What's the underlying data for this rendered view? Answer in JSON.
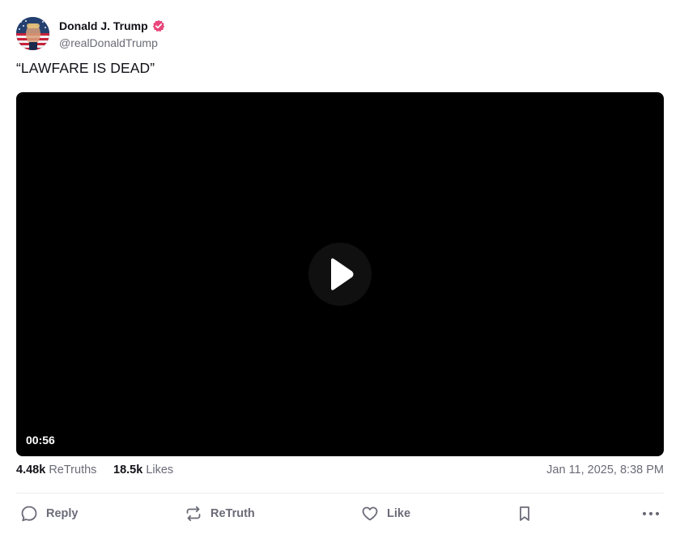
{
  "author": {
    "display_name": "Donald J. Trump",
    "handle": "@realDonaldTrump",
    "verified": true,
    "verified_color": "#e8457a"
  },
  "post": {
    "text": "“LAWFARE IS DEAD”",
    "video": {
      "duration": "00:56"
    }
  },
  "stats": {
    "retruths_count": "4.48k",
    "retruths_label": "ReTruths",
    "likes_count": "18.5k",
    "likes_label": "Likes",
    "timestamp": "Jan 11, 2025, 8:38 PM"
  },
  "actions": {
    "reply": "Reply",
    "retruth": "ReTruth",
    "like": "Like"
  },
  "icons": [
    "verified-badge-icon",
    "play-icon",
    "reply-icon",
    "retruth-icon",
    "like-icon",
    "bookmark-icon",
    "more-icon"
  ]
}
